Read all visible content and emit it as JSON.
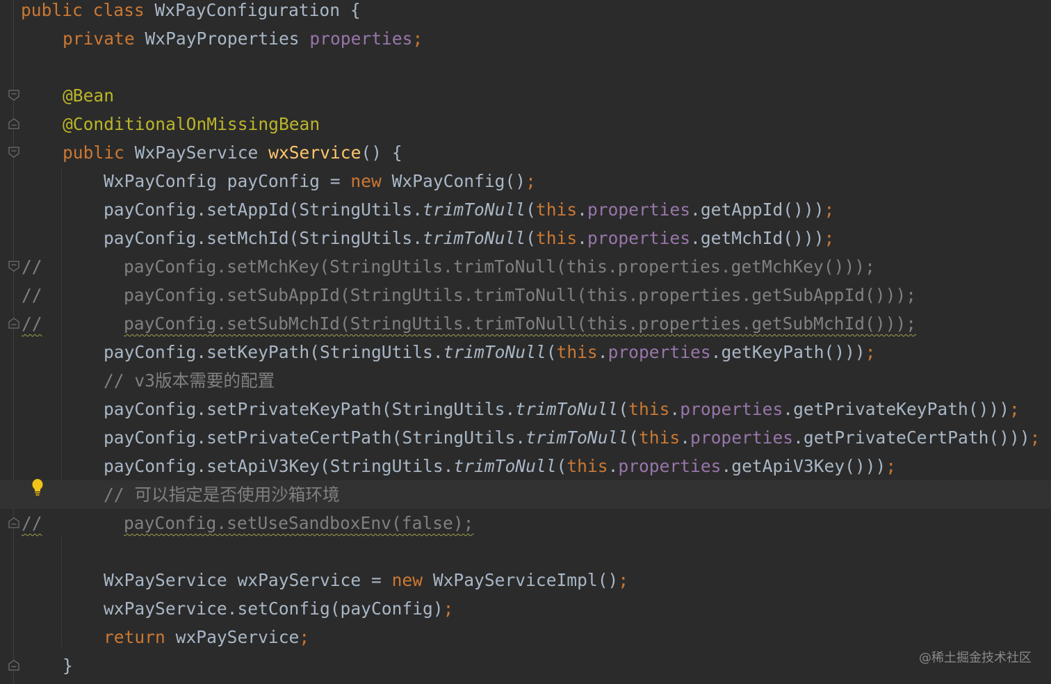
{
  "editor": {
    "colors": {
      "background": "#2b2b2b",
      "text": "#a9b7c6",
      "keyword": "#cc7832",
      "annotation": "#bbb529",
      "method_declaration": "#ffc66d",
      "field": "#9876aa",
      "comment": "#808080",
      "current_line": "#323232"
    },
    "lines": [
      {
        "tokens": [
          {
            "t": "public class",
            "c": "kw"
          },
          {
            "t": " WxPayConfiguration {"
          }
        ]
      },
      {
        "tokens": [
          {
            "t": "private",
            "c": "kw"
          },
          {
            "t": " WxPayProperties "
          },
          {
            "t": "properties",
            "c": "field"
          },
          {
            "t": ";",
            "c": "kw"
          }
        ]
      },
      {
        "tokens": []
      },
      {
        "tokens": [
          {
            "t": "@Bean",
            "c": "ann"
          }
        ]
      },
      {
        "tokens": [
          {
            "t": "@ConditionalOnMissingBean",
            "c": "ann"
          }
        ]
      },
      {
        "tokens": [
          {
            "t": "public",
            "c": "kw"
          },
          {
            "t": " WxPayService "
          },
          {
            "t": "wxService",
            "c": "fn"
          },
          {
            "t": "() {"
          }
        ]
      },
      {
        "tokens": [
          {
            "t": "WxPayConfig payConfig = "
          },
          {
            "t": "new",
            "c": "kw"
          },
          {
            "t": " WxPayConfig()"
          },
          {
            "t": ";",
            "c": "kw"
          }
        ]
      },
      {
        "tokens": [
          {
            "t": "payConfig.setAppId(StringUtils."
          },
          {
            "t": "trimToNull",
            "c": "it"
          },
          {
            "t": "("
          },
          {
            "t": "this",
            "c": "kw"
          },
          {
            "t": "."
          },
          {
            "t": "properties",
            "c": "field"
          },
          {
            "t": ".getAppId()))"
          },
          {
            "t": ";",
            "c": "kw"
          }
        ]
      },
      {
        "tokens": [
          {
            "t": "payConfig.setMchId(StringUtils."
          },
          {
            "t": "trimToNull",
            "c": "it"
          },
          {
            "t": "("
          },
          {
            "t": "this",
            "c": "kw"
          },
          {
            "t": "."
          },
          {
            "t": "properties",
            "c": "field"
          },
          {
            "t": ".getMchId()))"
          },
          {
            "t": ";",
            "c": "kw"
          }
        ]
      },
      {
        "comment_prefix": "//",
        "tokens": [
          {
            "t": "payConfig.setMchKey(StringUtils.trimToNull(this.properties.getMchKey()));",
            "c": "cm"
          }
        ]
      },
      {
        "comment_prefix": "//",
        "tokens": [
          {
            "t": "payConfig.setSubAppId(StringUtils.trimToNull(this.properties.getSubAppId()));",
            "c": "cm"
          }
        ]
      },
      {
        "comment_prefix": "//",
        "tokens": [
          {
            "t": "payConfig.setSubMchId(StringUtils.trimToNull(this.properties.getSubMchId()));",
            "c": "cm"
          }
        ]
      },
      {
        "tokens": [
          {
            "t": "payConfig.setKeyPath(StringUtils."
          },
          {
            "t": "trimToNull",
            "c": "it"
          },
          {
            "t": "("
          },
          {
            "t": "this",
            "c": "kw"
          },
          {
            "t": "."
          },
          {
            "t": "properties",
            "c": "field"
          },
          {
            "t": ".getKeyPath()))"
          },
          {
            "t": ";",
            "c": "kw"
          }
        ]
      },
      {
        "tokens": [
          {
            "t": "// v3版本需要的配置",
            "c": "cm"
          }
        ]
      },
      {
        "tokens": [
          {
            "t": "payConfig.setPrivateKeyPath(StringUtils."
          },
          {
            "t": "trimToNull",
            "c": "it"
          },
          {
            "t": "("
          },
          {
            "t": "this",
            "c": "kw"
          },
          {
            "t": "."
          },
          {
            "t": "properties",
            "c": "field"
          },
          {
            "t": ".getPrivateKeyPath()))"
          },
          {
            "t": ";",
            "c": "kw"
          }
        ]
      },
      {
        "tokens": [
          {
            "t": "payConfig.setPrivateCertPath(StringUtils."
          },
          {
            "t": "trimToNull",
            "c": "it"
          },
          {
            "t": "("
          },
          {
            "t": "this",
            "c": "kw"
          },
          {
            "t": "."
          },
          {
            "t": "properties",
            "c": "field"
          },
          {
            "t": ".getPrivateCertPath()))"
          },
          {
            "t": ";",
            "c": "kw"
          }
        ]
      },
      {
        "tokens": [
          {
            "t": "payConfig.setApiV3Key(StringUtils."
          },
          {
            "t": "trimToNull",
            "c": "it"
          },
          {
            "t": "("
          },
          {
            "t": "this",
            "c": "kw"
          },
          {
            "t": "."
          },
          {
            "t": "properties",
            "c": "field"
          },
          {
            "t": ".getApiV3Key()))"
          },
          {
            "t": ";",
            "c": "kw"
          }
        ]
      },
      {
        "tokens": [
          {
            "t": "// 可以指定是否使用沙箱环境",
            "c": "cm"
          }
        ]
      },
      {
        "comment_prefix": "//",
        "tokens": [
          {
            "t": "payConfig.setUseSandboxEnv(false);",
            "c": "cm"
          }
        ]
      },
      {
        "tokens": []
      },
      {
        "tokens": [
          {
            "t": "WxPayService wxPayService = "
          },
          {
            "t": "new",
            "c": "kw"
          },
          {
            "t": " WxPayServiceImpl()"
          },
          {
            "t": ";",
            "c": "kw"
          }
        ]
      },
      {
        "tokens": [
          {
            "t": "wxPayService.setConfig(payConfig)"
          },
          {
            "t": ";",
            "c": "kw"
          }
        ]
      },
      {
        "tokens": [
          {
            "t": "return",
            "c": "kw"
          },
          {
            "t": " wxPayService"
          },
          {
            "t": ";",
            "c": "kw"
          }
        ]
      },
      {
        "tokens": [
          {
            "t": "}"
          }
        ]
      }
    ]
  },
  "gutter": {
    "fold_icons": [
      "fold-open-icon",
      "fold-close-icon",
      "fold-open-icon",
      "fold-open-icon",
      "fold-close-icon",
      "fold-open-icon",
      "fold-close-icon",
      "fold-close-icon"
    ],
    "bulb_icon": "lightbulb-icon"
  },
  "watermark": "@稀土掘金技术社区"
}
